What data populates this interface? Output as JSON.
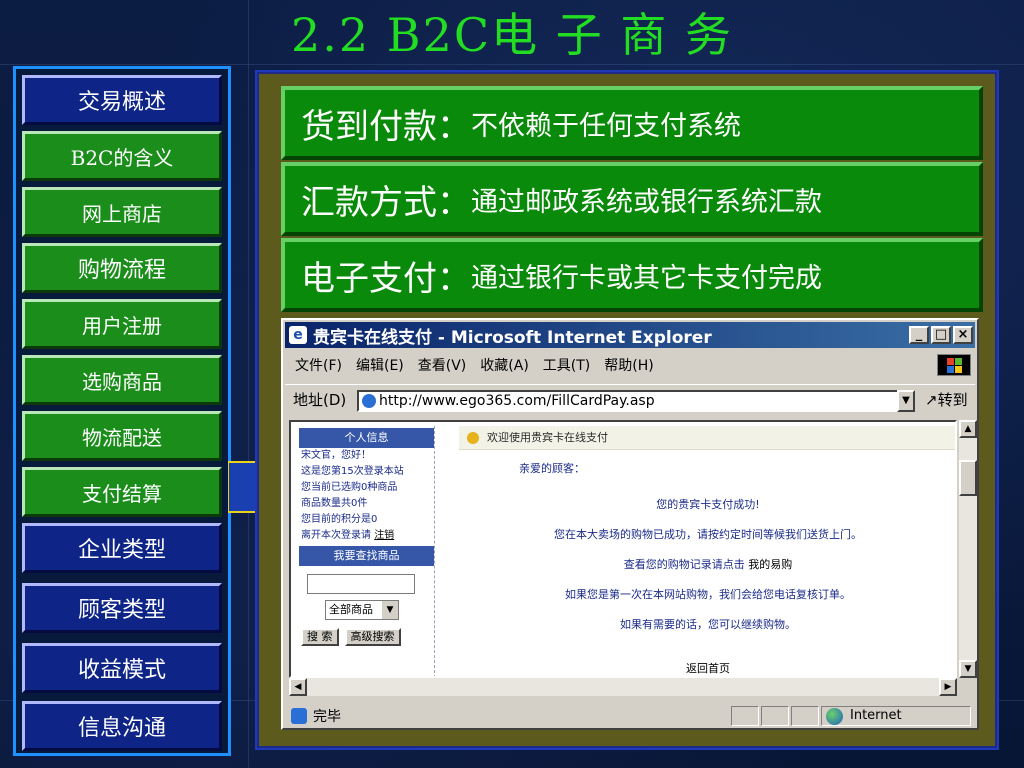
{
  "title": "2.2 B2C电 子 商 务",
  "sidebar": {
    "items": [
      {
        "label": "交易概述",
        "style": "blue"
      },
      {
        "label": "B2C的含义",
        "style": "green"
      },
      {
        "label": "网上商店",
        "style": "green"
      },
      {
        "label": "购物流程",
        "style": "green"
      },
      {
        "label": "用户注册",
        "style": "green"
      },
      {
        "label": "选购商品",
        "style": "green"
      },
      {
        "label": "物流配送",
        "style": "green"
      },
      {
        "label": "支付结算",
        "style": "green"
      },
      {
        "label": "企业类型",
        "style": "blue"
      },
      {
        "label": "顾客类型",
        "style": "blue"
      },
      {
        "label": "收益模式",
        "style": "blue"
      },
      {
        "label": "信息沟通",
        "style": "blue"
      }
    ]
  },
  "content": {
    "boxes": [
      {
        "label": "货到付款：",
        "text": "不依赖于任何支付系统"
      },
      {
        "label": "汇款方式：",
        "text": "通过邮政系统或银行系统汇款"
      },
      {
        "label": "电子支付：",
        "text": "通过银行卡或其它卡支付完成"
      }
    ]
  },
  "browser": {
    "title": "贵宾卡在线支付 - Microsoft Internet Explorer",
    "window_buttons": {
      "minimize": "_",
      "maximize": "□",
      "close": "×"
    },
    "menu": [
      "文件(F)",
      "编辑(E)",
      "查看(V)",
      "收藏(A)",
      "工具(T)",
      "帮助(H)"
    ],
    "address_label": "地址(D)",
    "url": "http://www.ego365.com/FillCardPay.asp",
    "go_label": "转到",
    "status_text": "完毕",
    "zone_text": "Internet",
    "page": {
      "left_header_1": "个人信息",
      "left_lines": [
        "宋文官，您好！",
        "这是您第15次登录本站",
        "您当前已选购0种商品",
        "商品数量共0件",
        "您目前的积分是0"
      ],
      "leave_text": "离开本次登录请",
      "logout": "注销",
      "left_header_2": "我要查找商品",
      "category_select": "全部商品",
      "search_button": "搜 索",
      "advanced_search_button": "高级搜索",
      "welcome": "欢迎使用贵宾卡在线支付",
      "greeting": "亲爱的顾客：",
      "success": "您的贵宾卡支付成功!",
      "line1": "您在本大卖场的购物已成功，请按约定时间等候我们送货上门。",
      "line2_prefix": "查看您的购物记录请点击",
      "my_orders": "我的易购",
      "line3": "如果您是第一次在本网站购物，我们会给您电话复核订单。",
      "line4": "如果有需要的话，您可以继续购物。",
      "home_link": "返回首页"
    }
  },
  "colors": {
    "title": "#22dd22",
    "nav_green": "#1b8d1b",
    "nav_blue": "#0e2486",
    "content_bg": "#5d5a1d",
    "info_box": "#0a8a0a"
  }
}
